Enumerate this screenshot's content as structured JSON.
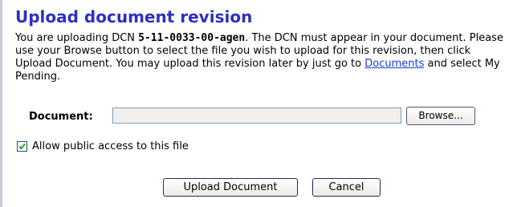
{
  "page": {
    "title": "Upload document revision"
  },
  "intro": {
    "part1": "You are uploading DCN ",
    "dcn": "5-11-0033-00-agen",
    "part2": ". The DCN must appear in your document. Please use your Browse button to select the file you wish to upload for this revision, then click Upload Document. You may upload this revision later by just go to ",
    "link_text": "Documents",
    "part3": " and select My Pending."
  },
  "form": {
    "document_label": "Document:",
    "document_value": "",
    "browse_label": "Browse...",
    "public_access_label": "Allow public access to this file",
    "public_access_checked": true
  },
  "actions": {
    "upload_label": "Upload Document",
    "cancel_label": "Cancel"
  },
  "colors": {
    "title": "#2f30c0",
    "link": "#1a3fd6",
    "checkmark": "#21a121"
  },
  "icons": {
    "checkbox_state": "check-icon"
  }
}
